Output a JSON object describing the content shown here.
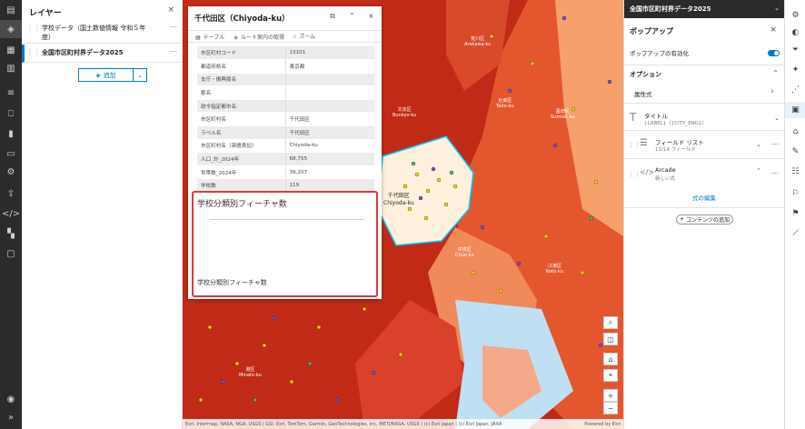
{
  "layers_panel": {
    "title": "レイヤー",
    "close": "×",
    "layers": [
      {
        "name": "学校データ（国土数値情報 令和５年度）",
        "more": "⋯"
      },
      {
        "name": "全国市区町村界データ2025",
        "more": "⋯"
      }
    ],
    "add_label": "追加",
    "add_chevron": "⌄"
  },
  "map": {
    "labels": [
      {
        "line1": "千代田区",
        "line2": "Chiyoda-ku"
      },
      {
        "line1": "文京区",
        "line2": "Bunkyo-ku"
      },
      {
        "line1": "台東区",
        "line2": "Taito-ku"
      },
      {
        "line1": "中央区",
        "line2": "Chuo-ku"
      },
      {
        "line1": "港区",
        "line2": "Minato-ku"
      },
      {
        "line1": "荒川区",
        "line2": "Arakawa-ku"
      },
      {
        "line1": "墨田区",
        "line2": "Sumida-ku"
      },
      {
        "line1": "江東区",
        "line2": "Koto-ku"
      }
    ],
    "attribution": "Esri, Intermap, NASA, NGA, USGS | GSI, Esri, TomTom, Garmin, GeoTechnologies, Inc, METI/NASA, USGS | (c) Esri Japan | (c) Esri Japan, JAXA",
    "powered_by": "Powered by Esri",
    "controls": [
      "search-icon",
      "layers-icon",
      "home-icon",
      "compass-icon"
    ],
    "zoom_in": "+",
    "zoom_out": "−"
  },
  "popup": {
    "title": "千代田区（Chiyoda-ku）",
    "actions": [
      {
        "icon": "table-icon",
        "label": "テーブル"
      },
      {
        "icon": "route-icon",
        "label": "ルート案内の取得"
      },
      {
        "icon": "zoom-icon",
        "label": "ズーム"
      }
    ],
    "fields": [
      {
        "key": "市区町村コード",
        "value": "13101"
      },
      {
        "key": "都道府県名",
        "value": "東京都"
      },
      {
        "key": "支庁・振興局名",
        "value": ""
      },
      {
        "key": "郡名",
        "value": ""
      },
      {
        "key": "政令指定都市名",
        "value": ""
      },
      {
        "key": "市区町村名",
        "value": "千代田区"
      },
      {
        "key": "ラベル名",
        "value": "千代田区"
      },
      {
        "key": "市区町村名（英語表記）",
        "value": "Chiyoda-ku"
      },
      {
        "key": "人口_計_2024年",
        "value": "68,755"
      },
      {
        "key": "世帯数_2024年",
        "value": "39,207"
      },
      {
        "key": "学校数",
        "value": "119"
      }
    ],
    "chart_title": "学校分類別フィーチャ数",
    "chart_caption": "学校分類別フィーチャ数"
  },
  "right_panel": {
    "header": "全国市区町村界データ2025",
    "popup_title": "ポップアップ",
    "enable_label": "ポップアップの有効化",
    "options_title": "オプション",
    "attr_expr": "属性式",
    "title_label": "タイトル",
    "title_value": "{LABEL}（{CITY_ENG}）",
    "fieldlist_label": "フィールド リスト",
    "fieldlist_sub": "11/14 フィールド",
    "arcade_label": "Arcade",
    "arcade_sub": "新しい式",
    "edit_expr": "式の編集",
    "add_content": "コンテンツの追加"
  },
  "colors": {
    "map_dark": "#c12a17",
    "map_mid": "#e4572e",
    "map_light": "#f6a06c",
    "selected": "#fdf1dd",
    "water": "#bfe0f2",
    "accent": "#007ac2",
    "highlight_border": "#d83a3a"
  }
}
